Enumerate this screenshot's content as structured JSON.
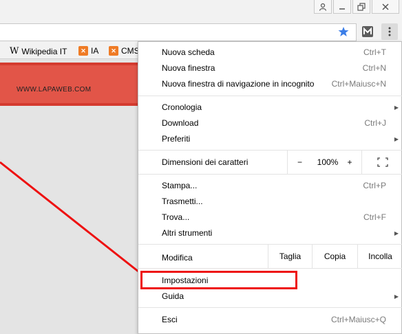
{
  "toolbar": {
    "star_icon": "star-icon",
    "extension_icon": "m-extension-icon",
    "menu_icon": "kebab-icon"
  },
  "bookmarks": [
    {
      "label": "Wikipedia IT",
      "icon": "wikipedia-icon"
    },
    {
      "label": "IA",
      "icon": "x-icon"
    },
    {
      "label": "CMS",
      "icon": "x-icon"
    }
  ],
  "page": {
    "banner_text": "WWW.LAPAWEB.COM",
    "banner_color": "#e25548"
  },
  "menu": {
    "nuova_scheda": {
      "label": "Nuova scheda",
      "shortcut": "Ctrl+T"
    },
    "nuova_finestra": {
      "label": "Nuova finestra",
      "shortcut": "Ctrl+N"
    },
    "incognito": {
      "label": "Nuova finestra di navigazione in incognito",
      "shortcut": "Ctrl+Maiusc+N"
    },
    "cronologia": {
      "label": "Cronologia"
    },
    "download": {
      "label": "Download",
      "shortcut": "Ctrl+J"
    },
    "preferiti": {
      "label": "Preferiti"
    },
    "zoom": {
      "label": "Dimensioni dei caratteri",
      "minus": "−",
      "value": "100%",
      "plus": "+"
    },
    "stampa": {
      "label": "Stampa...",
      "shortcut": "Ctrl+P"
    },
    "trasmetti": {
      "label": "Trasmetti..."
    },
    "trova": {
      "label": "Trova...",
      "shortcut": "Ctrl+F"
    },
    "altri_strumenti": {
      "label": "Altri strumenti"
    },
    "modifica": {
      "label": "Modifica",
      "taglia": "Taglia",
      "copia": "Copia",
      "incolla": "Incolla"
    },
    "impostazioni": {
      "label": "Impostazioni"
    },
    "guida": {
      "label": "Guida"
    },
    "esci": {
      "label": "Esci",
      "shortcut": "Ctrl+Maiusc+Q"
    }
  },
  "annotation": {
    "color": "#ee1111"
  }
}
